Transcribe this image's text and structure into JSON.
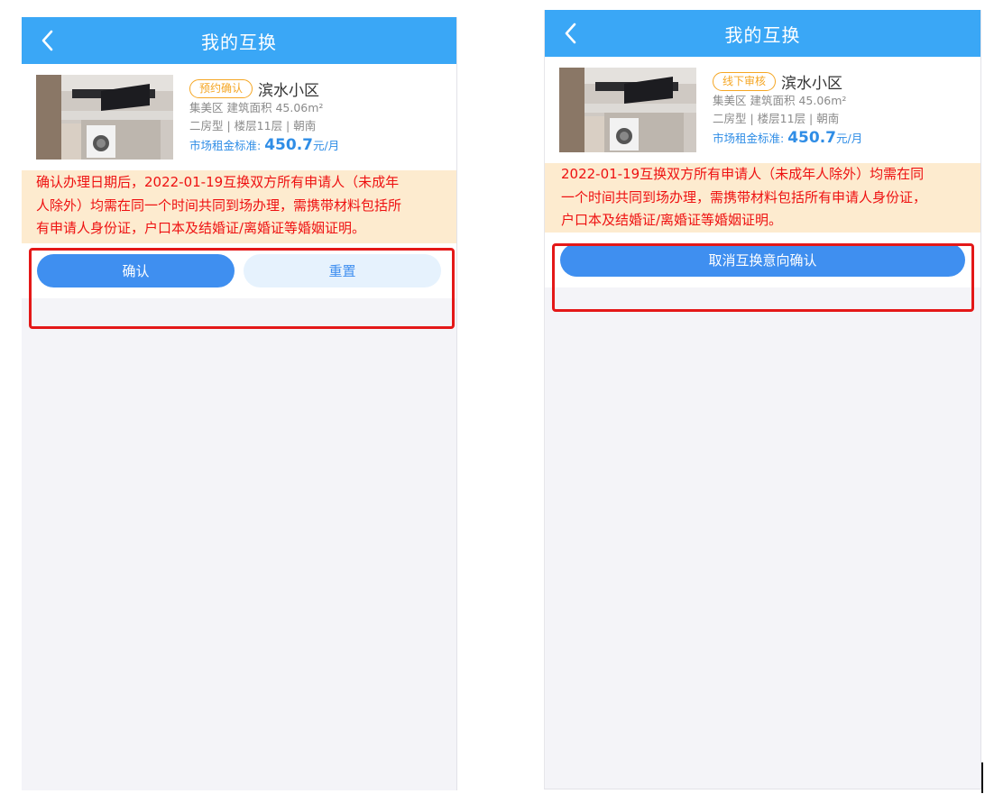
{
  "left_screen": {
    "nav": {
      "title": "我的互换"
    },
    "house": {
      "status_tag": "预约确认",
      "community": "滨水小区",
      "district_area": "集美区   建筑面积 45.06m²",
      "layout": "二房型 | 楼层11层 | 朝南",
      "rent_label": "市场租金标准:",
      "rent_value": "450.7",
      "rent_unit": "元/月"
    },
    "notice_lines": [
      "确认办理日期后，2022-01-19互换双方所有申请人（未成年",
      "人除外）均需在同一个时间共同到场办理，需携带材料包括所",
      "有申请人身份证，户口本及结婚证/离婚证等婚姻证明。"
    ],
    "buttons": {
      "confirm": "确认",
      "reset": "重置"
    }
  },
  "right_screen": {
    "nav": {
      "title": "我的互换"
    },
    "house": {
      "status_tag": "线下审核",
      "community": "滨水小区",
      "district_area": "集美区   建筑面积 45.06m²",
      "layout": "二房型 | 楼层11层 | 朝南",
      "rent_label": "市场租金标准:",
      "rent_value": "450.7",
      "rent_unit": "元/月"
    },
    "notice_lines": [
      "2022-01-19互换双方所有申请人（未成年人除外）均需在同",
      "一个时间共同到场办理，需携带材料包括所有申请人身份证，",
      "户口本及结婚证/离婚证等婚姻证明。"
    ],
    "buttons": {
      "cancel_intent": "取消互换意向确认"
    }
  },
  "colors": {
    "nav_bg": "#3aa7f6",
    "primary_button": "#3f8ff0",
    "secondary_button": "#e6f2fd",
    "status_tag": "#f5a623",
    "notice_bg": "#fdebcf",
    "notice_text": "#ee1111",
    "highlight_box": "#e41818"
  },
  "icons": {
    "back": "chevron-left-icon",
    "thumbnail": "kitchen-photo"
  }
}
